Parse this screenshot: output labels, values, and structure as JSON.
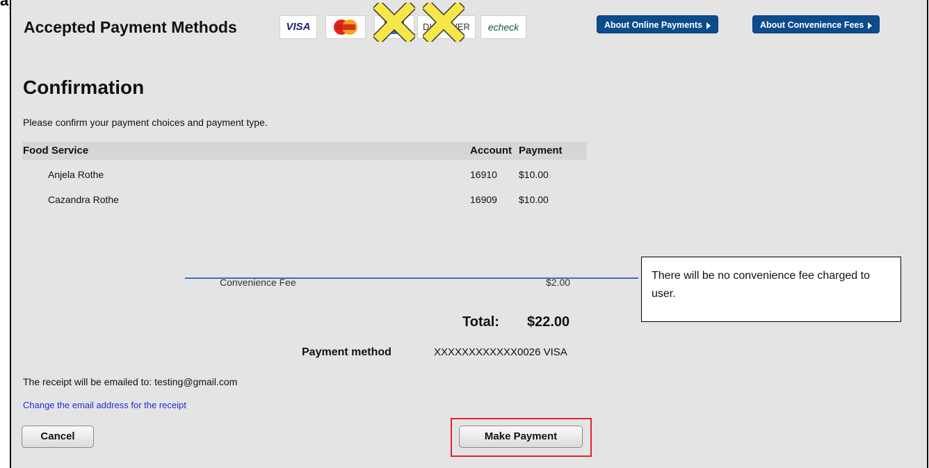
{
  "page": {
    "top_partial_title": "ayments"
  },
  "header": {
    "title": "Accepted Payment Methods",
    "logos": {
      "visa": "VISA",
      "mastercard": "MasterCard",
      "discover": "DISCOVER",
      "echeck": "echeck"
    },
    "about_online_payments": "About Online Payments",
    "about_convenience_fees": "About Convenience Fees"
  },
  "confirmation": {
    "heading": "Confirmation",
    "instruction": "Please confirm your payment choices and payment type.",
    "table": {
      "columns": [
        "Food Service",
        "Account",
        "Payment"
      ],
      "rows": [
        {
          "name": "Anjela  Rothe",
          "account": "16910",
          "payment": "$10.00"
        },
        {
          "name": "Cazandra  Rothe",
          "account": "16909",
          "payment": "$10.00"
        }
      ]
    },
    "convenience_fee": {
      "label": "Convenience Fee",
      "value": "$2.00"
    },
    "total": {
      "label": "Total:",
      "value": "$22.00"
    },
    "payment_method": {
      "label": "Payment method",
      "value": "XXXXXXXXXXXX0026 VISA"
    },
    "receipt_text": "The receipt will be emailed to: testing@gmail.com",
    "change_email_link": "Change the email address for the receipt",
    "cancel_label": "Cancel",
    "make_payment_label": "Make Payment"
  },
  "annotation": {
    "callout_text": "There will be no convenience fee charged to user."
  },
  "colors": {
    "brand_button": "#0c4c8c",
    "highlight_box": "#e0242a",
    "link": "#1f2ad6",
    "strike_line": "#3a6fb5",
    "x_mark": "#f5e64a"
  }
}
